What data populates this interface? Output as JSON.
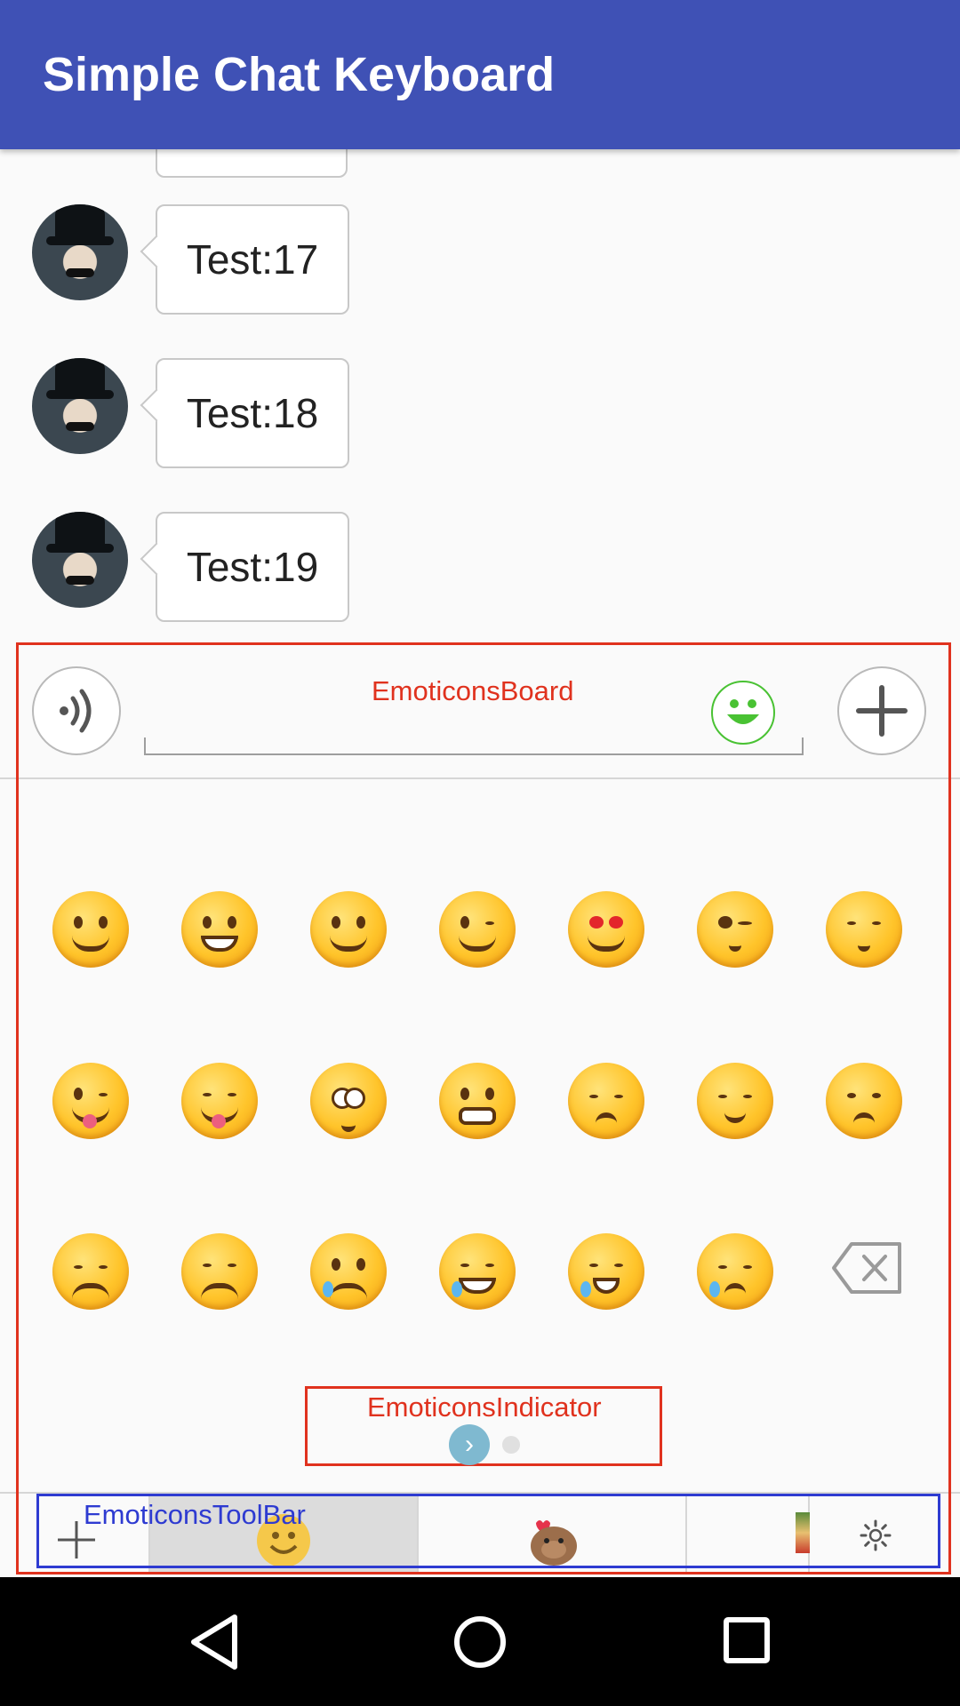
{
  "app": {
    "title": "Simple Chat Keyboard"
  },
  "messages": [
    {
      "text": "Test:17"
    },
    {
      "text": "Test:18"
    },
    {
      "text": "Test:19"
    }
  ],
  "annotations": {
    "board": "EmoticonsBoard",
    "indicator": "EmoticonsIndicator",
    "toolbar": "EmoticonsToolBar"
  },
  "emoticons": [
    [
      "grinning-face",
      "smiley-face",
      "blush-face",
      "wink-face",
      "heart-eyes-face",
      "kissing-heart-face",
      "kissing-closed-eyes-face"
    ],
    [
      "wink-tongue-face",
      "squint-tongue-face",
      "flushed-face",
      "grimacing-face",
      "pensive-face",
      "relieved-face",
      "unamused-face"
    ],
    [
      "disappointed-face",
      "confounded-face",
      "crying-face",
      "tears-of-joy-face",
      "sobbing-face",
      "sleepy-face",
      "backspace-icon"
    ]
  ],
  "colors": {
    "appbar": "#3f51b5",
    "annotation_red": "#e0321e",
    "annotation_blue": "#2e3bd1",
    "emoji_toggle_green": "#49c233"
  },
  "indicator": {
    "pages": 2,
    "current": 1
  }
}
